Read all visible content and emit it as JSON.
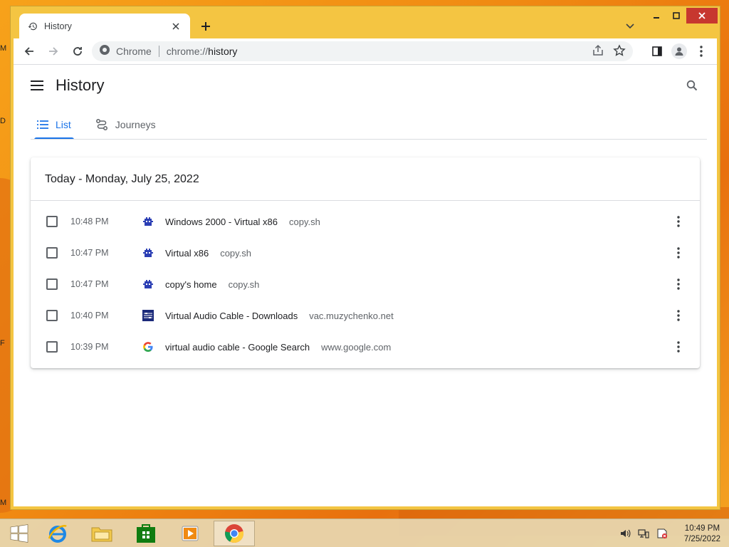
{
  "desktop": {
    "edge_letters": [
      "M",
      "D",
      "F",
      "M"
    ]
  },
  "window": {
    "tab": {
      "title": "History",
      "icon": "history-icon",
      "close_icon": "close-icon"
    },
    "new_tab_icon": "plus-icon",
    "tab_search_icon": "chevron-down-icon",
    "controls": {
      "minimize_icon": "minimize-icon",
      "maximize_icon": "maximize-icon",
      "close_icon": "close-icon"
    }
  },
  "toolbar": {
    "back_icon": "back-arrow-icon",
    "forward_icon": "forward-arrow-icon",
    "reload_icon": "reload-icon",
    "omnibox": {
      "site_label": "Chrome",
      "url_scheme": "chrome://",
      "url_path": "history"
    },
    "share_icon": "share-icon",
    "bookmark_icon": "star-icon",
    "sidepanel_icon": "side-panel-icon",
    "profile_icon": "profile-icon",
    "menu_icon": "kebab-menu-icon"
  },
  "history": {
    "title": "History",
    "tabs": [
      {
        "label": "List",
        "icon": "list-icon",
        "active": true
      },
      {
        "label": "Journeys",
        "icon": "journeys-icon",
        "active": false
      }
    ],
    "day_heading": "Today - Monday, July 25, 2022",
    "entries": [
      {
        "time": "10:48 PM",
        "title": "Windows 2000 - Virtual x86",
        "domain": "copy.sh",
        "favicon": "copy-sh-favicon"
      },
      {
        "time": "10:47 PM",
        "title": "Virtual x86",
        "domain": "copy.sh",
        "favicon": "copy-sh-favicon"
      },
      {
        "time": "10:47 PM",
        "title": "copy's home",
        "domain": "copy.sh",
        "favicon": "copy-sh-favicon"
      },
      {
        "time": "10:40 PM",
        "title": "Virtual Audio Cable - Downloads",
        "domain": "vac.muzychenko.net",
        "favicon": "vac-favicon"
      },
      {
        "time": "10:39 PM",
        "title": "virtual audio cable - Google Search",
        "domain": "www.google.com",
        "favicon": "google-favicon"
      }
    ]
  },
  "taskbar": {
    "start_icon": "windows-start-icon",
    "pinned": [
      {
        "name": "internet-explorer-icon"
      },
      {
        "name": "file-explorer-icon"
      },
      {
        "name": "store-icon"
      },
      {
        "name": "media-player-icon"
      },
      {
        "name": "chrome-icon",
        "active": true
      }
    ],
    "tray_icons": [
      "volume-icon",
      "network-icon",
      "action-center-icon"
    ],
    "clock": {
      "time": "10:49 PM",
      "date": "7/25/2022"
    }
  },
  "colors": {
    "accent": "#1a73e8",
    "window_frame": "#f4c542",
    "close_button": "#c7372f"
  }
}
